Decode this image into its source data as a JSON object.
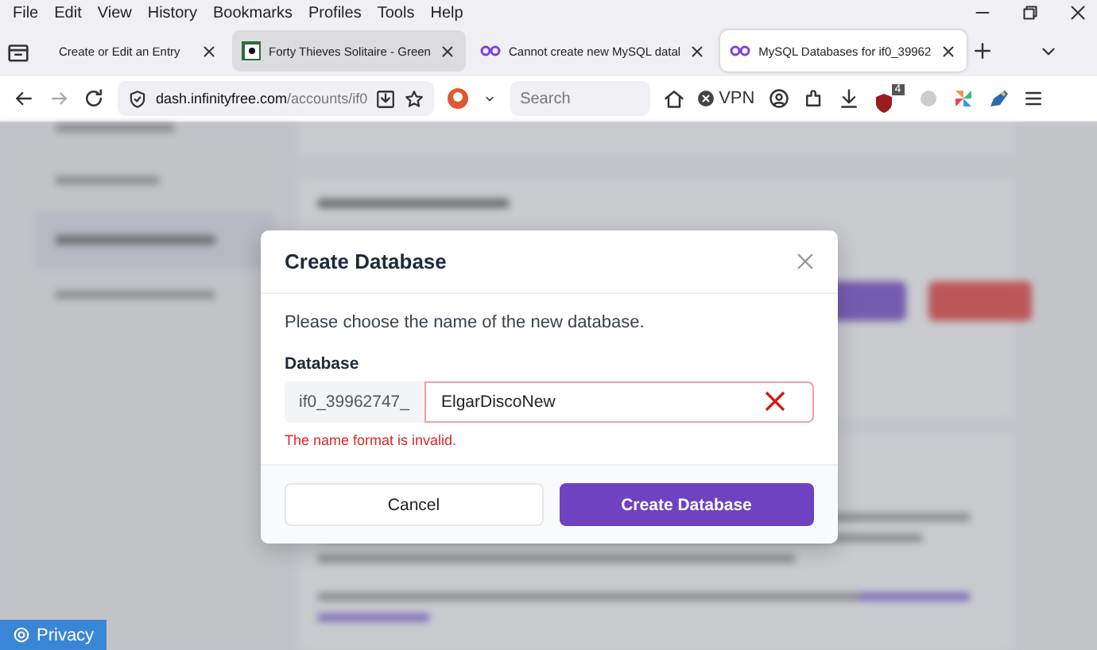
{
  "menu_bar": [
    "File",
    "Edit",
    "View",
    "History",
    "Bookmarks",
    "Profiles",
    "Tools",
    "Help"
  ],
  "tabs": [
    {
      "title": "Create or Edit an Entry",
      "selected": false,
      "kind": "plain"
    },
    {
      "title": "Forty Thieves Solitaire - Green",
      "selected": false,
      "kind": "cards"
    },
    {
      "title": "Cannot create new MySQL datal",
      "selected": false,
      "kind": "infinity"
    },
    {
      "title": "MySQL Databases for if0_39962",
      "selected": true,
      "kind": "infinity"
    }
  ],
  "address_bar": {
    "host": "dash.infinityfree.com",
    "path": "/accounts/if0"
  },
  "search": {
    "placeholder": "Search"
  },
  "toolbar": {
    "vpn": "VPN",
    "badge": "4"
  },
  "dialog": {
    "title": "Create Database",
    "prompt": "Please choose the name of the new database.",
    "field_label": "Database",
    "prefix": "if0_39962747_",
    "value": "ElgarDiscoNew",
    "invalid": true,
    "error": "The name format is invalid.",
    "buttons": [
      {
        "label": "Cancel",
        "kind": "secondary"
      },
      {
        "label": "Create Database",
        "kind": "primary"
      }
    ]
  },
  "privacy_button": "Privacy"
}
